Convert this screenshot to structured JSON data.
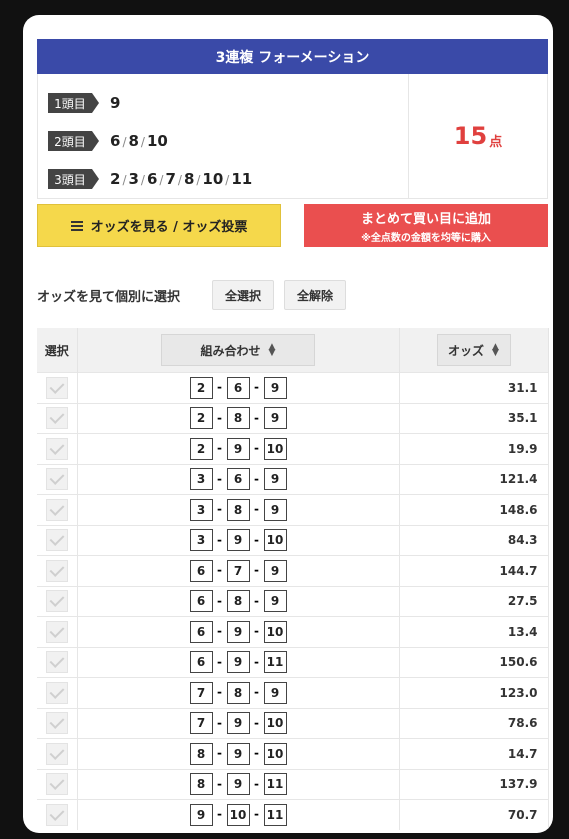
{
  "title": "3連複 フォーメーション",
  "formation": [
    {
      "label": "1頭目",
      "values": [
        "9"
      ]
    },
    {
      "label": "2頭目",
      "values": [
        "6",
        "8",
        "10"
      ]
    },
    {
      "label": "3頭目",
      "values": [
        "2",
        "3",
        "6",
        "7",
        "8",
        "10",
        "11"
      ]
    }
  ],
  "points": {
    "count": "15",
    "unit": "点"
  },
  "buttons": {
    "odds": "オッズを見る / オッズ投票",
    "add_main": "まとめて買い目に追加",
    "add_sub": "※全点数の金額を均等に購入"
  },
  "select": {
    "label": "オッズを見て個別に選択",
    "all": "全選択",
    "clear": "全解除"
  },
  "table": {
    "headers": {
      "select": "選択",
      "combo": "組み合わせ",
      "odds": "オッズ"
    },
    "rows": [
      {
        "combo": [
          "2",
          "6",
          "9"
        ],
        "odds": "31.1"
      },
      {
        "combo": [
          "2",
          "8",
          "9"
        ],
        "odds": "35.1"
      },
      {
        "combo": [
          "2",
          "9",
          "10"
        ],
        "odds": "19.9"
      },
      {
        "combo": [
          "3",
          "6",
          "9"
        ],
        "odds": "121.4"
      },
      {
        "combo": [
          "3",
          "8",
          "9"
        ],
        "odds": "148.6"
      },
      {
        "combo": [
          "3",
          "9",
          "10"
        ],
        "odds": "84.3"
      },
      {
        "combo": [
          "6",
          "7",
          "9"
        ],
        "odds": "144.7"
      },
      {
        "combo": [
          "6",
          "8",
          "9"
        ],
        "odds": "27.5"
      },
      {
        "combo": [
          "6",
          "9",
          "10"
        ],
        "odds": "13.4"
      },
      {
        "combo": [
          "6",
          "9",
          "11"
        ],
        "odds": "150.6"
      },
      {
        "combo": [
          "7",
          "8",
          "9"
        ],
        "odds": "123.0"
      },
      {
        "combo": [
          "7",
          "9",
          "10"
        ],
        "odds": "78.6"
      },
      {
        "combo": [
          "8",
          "9",
          "10"
        ],
        "odds": "14.7"
      },
      {
        "combo": [
          "8",
          "9",
          "11"
        ],
        "odds": "137.9"
      },
      {
        "combo": [
          "9",
          "10",
          "11"
        ],
        "odds": "70.7"
      }
    ]
  },
  "colors": {
    "title_bg": "#3a4aa8",
    "points": "#e0403e",
    "yellow_button": "#f5d84b",
    "red_button": "#ea4f4f"
  }
}
